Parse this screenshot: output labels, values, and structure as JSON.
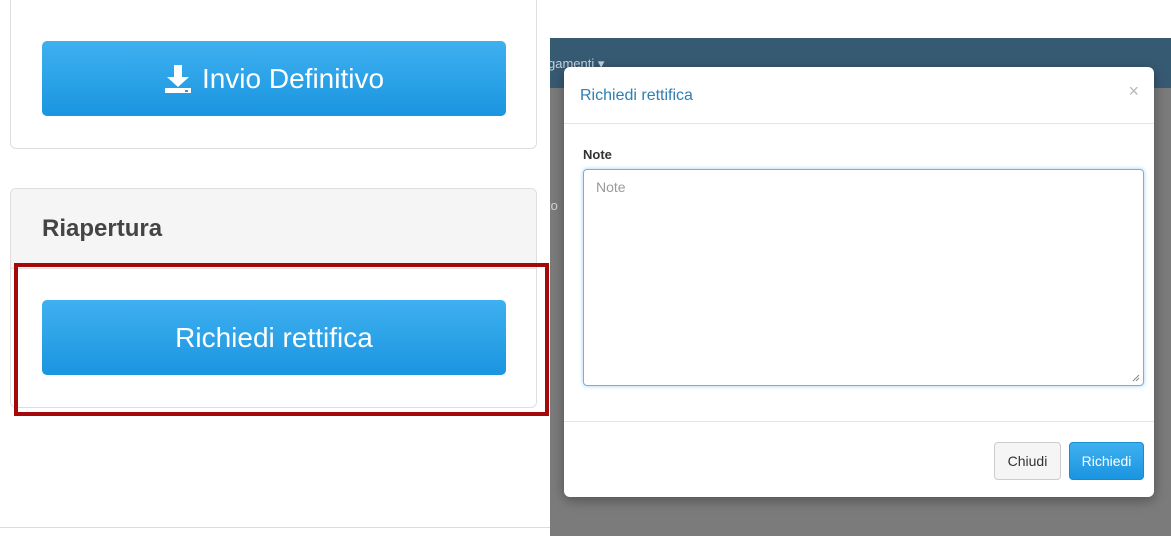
{
  "left_panel": {
    "invio_button_label": "Invio Definitivo",
    "riapertura_heading": "Riapertura",
    "rettifica_button_label": "Richiedi rettifica"
  },
  "background_page": {
    "nav_fragment": "gamenti ▾",
    "side_fragment": "to"
  },
  "modal": {
    "title": "Richiedi rettifica",
    "close_symbol": "×",
    "note_label": "Note",
    "note_placeholder": "Note",
    "note_value": "",
    "close_button_label": "Chiudi",
    "submit_button_label": "Richiedi"
  },
  "colors": {
    "primary_button": "#1a95e0",
    "highlight_box": "#a50808",
    "modal_title": "#2e7fb3",
    "navbar": "#375a73"
  },
  "icons": {
    "invio": "download-icon",
    "close": "close-icon"
  }
}
